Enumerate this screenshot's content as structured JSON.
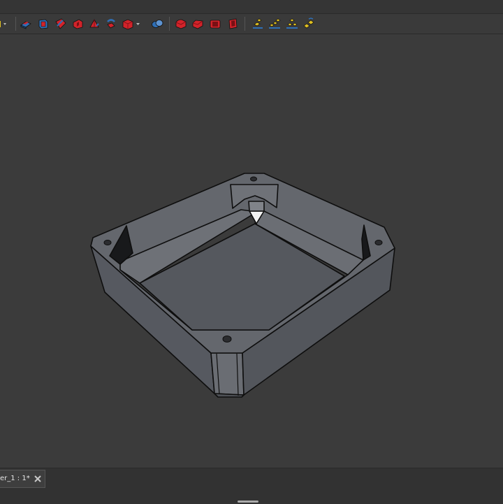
{
  "toolbar": {
    "buttons": [
      {
        "id": "open-file-dropdown-button",
        "icon": "folder-icon"
      },
      {
        "id": "pad-button",
        "icon": "pad-icon"
      },
      {
        "id": "pocket-button",
        "icon": "pocket-icon"
      },
      {
        "id": "revolution-button",
        "icon": "revolution-icon"
      },
      {
        "id": "groove-button",
        "icon": "groove-icon"
      },
      {
        "id": "additive-loft-button",
        "icon": "loft-icon"
      },
      {
        "id": "additive-pipe-button",
        "icon": "pipe-icon"
      },
      {
        "id": "additive-primitive-dropdown-button",
        "icon": "box-icon"
      },
      {
        "id": "boolean-button",
        "icon": "boolean-icon"
      },
      {
        "id": "fillet-button",
        "icon": "fillet-icon"
      },
      {
        "id": "chamfer-button",
        "icon": "chamfer-icon"
      },
      {
        "id": "draft-button",
        "icon": "draft-icon"
      },
      {
        "id": "thickness-button",
        "icon": "thickness-icon"
      },
      {
        "id": "mirrored-button",
        "icon": "mirror-icon"
      },
      {
        "id": "linear-pattern-button",
        "icon": "linear-pattern-icon"
      },
      {
        "id": "polar-pattern-button",
        "icon": "polar-pattern-icon"
      },
      {
        "id": "multitransform-button",
        "icon": "multitransform-icon"
      }
    ]
  },
  "tab": {
    "label": "er_1 : 1*",
    "close_icon": "close-icon"
  },
  "colors": {
    "viewport_bg": "#3b3b3b",
    "toolbar_bg": "#3a3a3a",
    "model_face": "#5c5e63",
    "model_edge": "#0e0e0e",
    "accent_red": "#d2232a",
    "accent_blue": "#2f6fb5",
    "accent_yellow": "#e0c021"
  }
}
